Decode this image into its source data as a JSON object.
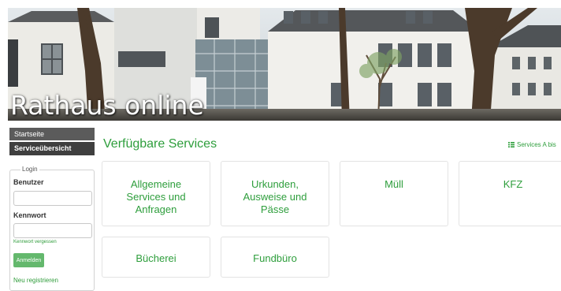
{
  "banner": {
    "title": "Rathaus online"
  },
  "nav": {
    "items": [
      {
        "label": "Startseite",
        "active": false
      },
      {
        "label": "Serviceübersicht",
        "active": true
      }
    ]
  },
  "login": {
    "legend": "Login",
    "user_label": "Benutzer",
    "user_value": "",
    "password_label": "Kennwort",
    "password_value": "",
    "forgot_link": "Kennwort vergessen",
    "submit_label": "Anmelden",
    "register_link": "Neu registrieren"
  },
  "main": {
    "title": "Verfügbare Services",
    "az_link": "Services A bis",
    "az_icon": "list-icon",
    "tiles": [
      {
        "label": "Allgemeine Services und Anfragen"
      },
      {
        "label": "Urkunden, Ausweise und Pässe"
      },
      {
        "label": "Müll"
      },
      {
        "label": "KFZ"
      },
      {
        "label": "Bücherei"
      },
      {
        "label": "Fundbüro"
      }
    ]
  },
  "colors": {
    "accent": "#2e9e3c",
    "button": "#64b86d",
    "nav_bg": "#5b5b5b",
    "nav_active_bg": "#3f3f3f"
  }
}
